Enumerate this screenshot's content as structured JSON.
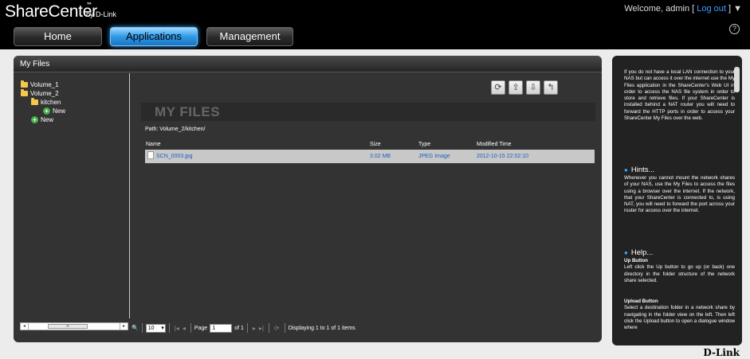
{
  "header": {
    "brand": "ShareCenter",
    "brand_tm": "™",
    "brand_by": "by D-Link",
    "welcome_prefix": "Welcome, admin [",
    "logout": "Log out",
    "welcome_suffix": "] ▼",
    "help_icon": "?",
    "nav": [
      {
        "label": "Home"
      },
      {
        "label": "Applications"
      },
      {
        "label": "Management"
      }
    ]
  },
  "panel": {
    "title": "My Files",
    "tree": [
      {
        "label": "Volume_1",
        "icon": "folder-icon"
      },
      {
        "label": "Volume_2",
        "icon": "folder-icon"
      },
      {
        "label": "kitchen",
        "icon": "folder-icon"
      },
      {
        "label": "New",
        "icon": "new-icon"
      },
      {
        "label": "New",
        "icon": "new-icon"
      }
    ],
    "tree_scroll": {
      "left": "◂",
      "thumb": "≡",
      "right": "▸"
    },
    "toolbar": [
      {
        "name": "refresh-icon",
        "glyph": "⟳"
      },
      {
        "name": "upload-icon",
        "glyph": "⇪"
      },
      {
        "name": "download-icon",
        "glyph": "⇩"
      },
      {
        "name": "up-folder-icon",
        "glyph": "↰"
      }
    ],
    "content_title": "MY FILES",
    "path": "Path:  Volume_2/kitchen/",
    "columns": {
      "name": "Name",
      "size": "Size",
      "type": "Type",
      "modified": "Modified Time"
    },
    "files": [
      {
        "name": "SCN_0003.jpg",
        "size": "3.02 MB",
        "type": "JPEG Image",
        "modified": "2012-10-15 22:02:10"
      }
    ],
    "pager": {
      "search_icon": "🔍",
      "page_size": "10",
      "first": "|◂",
      "prev": "◂",
      "page_label": "Page",
      "page_value": "1",
      "of_label": "of 1",
      "next": "▸",
      "last": "▸|",
      "refresh": "⟳",
      "status": "Displaying 1 to 1 of 1 items"
    }
  },
  "help": {
    "intro": "If you do not have a local LAN connection to your NAS but can access it over the internet use the My Files application in the ShareCenter's Web UI in order to access the NAS file system in order to store and retrieve files. If your ShareCenter is installed behind a NAT router you will need to forward the HTTP ports in order to access your ShareCenter My Files over the web.",
    "hints_title": "Hints...",
    "hints_text": "Whenever you cannot mount the network shares of your NAS, use the My Files to access the files using a browser over the internet. If the network, that your ShareCenter is connected to, is using NAT, you will need to forward the port across your router for access over the internet.",
    "help_title": "Help...",
    "up_title": "Up Button",
    "up_text": "Left click the Up button to go up (or back) one directory in the folder structure of the network share selected.",
    "upload_title": "Upload Button",
    "upload_text": "Select a destination folder in a network share by navigating in the folder view on the left. Then left click the Upload button to open a dialogue window where"
  },
  "footer_logo": "D-Link"
}
